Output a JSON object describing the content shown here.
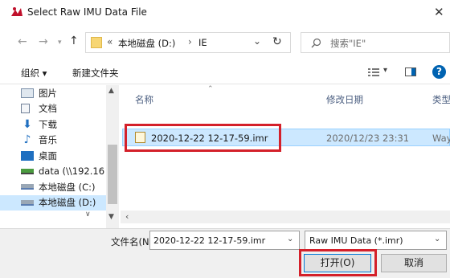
{
  "window": {
    "title": "Select Raw IMU Data File",
    "close_glyph": "✕"
  },
  "nav": {
    "back_glyph": "←",
    "forward_glyph": "→",
    "up_glyph": "↑",
    "breadcrumb_prefix": "«",
    "breadcrumb": [
      "本地磁盘 (D:)",
      "IE"
    ],
    "breadcrumb_sep": "›",
    "dropdown_glyph": "⌄",
    "refresh_glyph": "↻",
    "search_placeholder": "搜索\"IE\""
  },
  "toolbar": {
    "organize_label": "组织 ▾",
    "new_folder_label": "新建文件夹",
    "view_glyph": "▾",
    "help_glyph": "?"
  },
  "sidebar": {
    "items": [
      {
        "label": "图片",
        "icon": "pictures-icon"
      },
      {
        "label": "文档",
        "icon": "documents-icon"
      },
      {
        "label": "下载",
        "icon": "download-icon"
      },
      {
        "label": "音乐",
        "icon": "music-icon"
      },
      {
        "label": "桌面",
        "icon": "desktop-icon"
      },
      {
        "label": "data (\\\\192.16",
        "icon": "network-drive-icon"
      },
      {
        "label": "本地磁盘 (C:)",
        "icon": "drive-icon"
      },
      {
        "label": "本地磁盘 (D:)",
        "icon": "drive-icon",
        "selected": true
      }
    ]
  },
  "files": {
    "columns": [
      "名称",
      "修改日期",
      "类型"
    ],
    "rows": [
      {
        "name": "2020-12-22 12-17-59.imr",
        "modified": "2020/12/23 23:31",
        "type": "Way"
      }
    ]
  },
  "footer": {
    "filename_label": "文件名(N):",
    "filename_value": "2020-12-22 12-17-59.imr",
    "filter_value": "Raw IMU Data (*.imr)",
    "open_label": "打开(O)",
    "cancel_label": "取消"
  },
  "colors": {
    "highlight": "#d4202a",
    "selection": "#cce8ff",
    "accent": "#0063b1",
    "folder": "#f7d674"
  }
}
